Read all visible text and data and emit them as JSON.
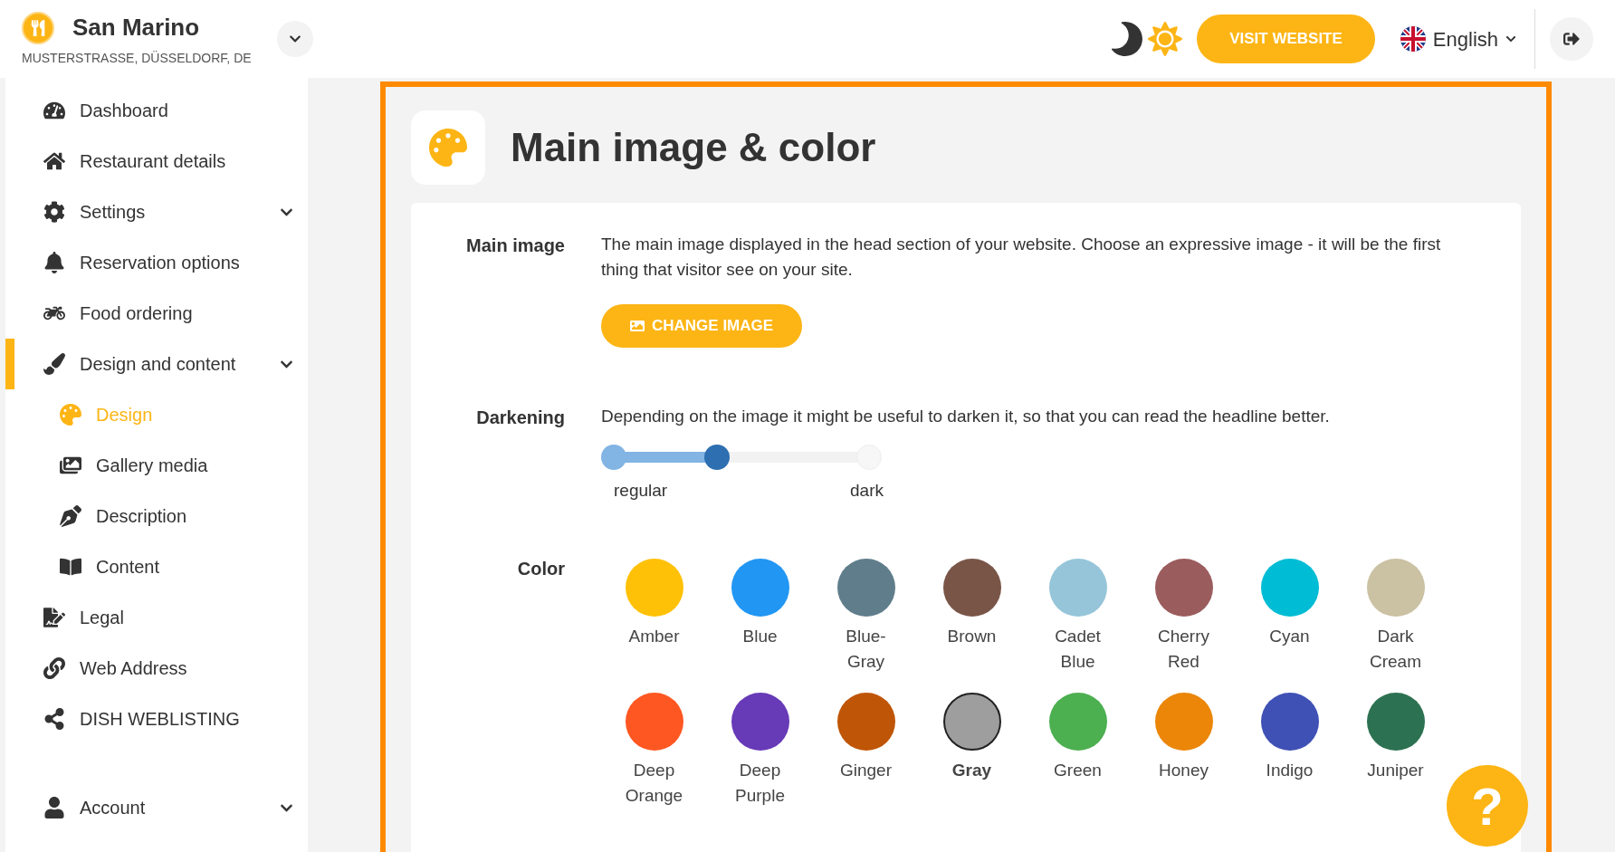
{
  "header": {
    "restaurant_name": "San Marino",
    "address": "MUSTERSTRASSE, DÜSSELDORF, DE",
    "visit_button": "VISIT WEBSITE",
    "language": "English"
  },
  "sidebar": {
    "items": [
      {
        "label": "Dashboard",
        "kind": "link",
        "selected": false
      },
      {
        "label": "Restaurant details",
        "kind": "link",
        "selected": false
      },
      {
        "label": "Settings",
        "kind": "group",
        "selected": false
      },
      {
        "label": "Reservation options",
        "kind": "link",
        "selected": false
      },
      {
        "label": "Food ordering",
        "kind": "link",
        "selected": false
      },
      {
        "label": "Design and content",
        "kind": "group",
        "selected": true,
        "children": [
          {
            "label": "Design",
            "selected": true
          },
          {
            "label": "Gallery media",
            "selected": false
          },
          {
            "label": "Description",
            "selected": false
          },
          {
            "label": "Content",
            "selected": false
          }
        ]
      },
      {
        "label": "Legal",
        "kind": "link",
        "selected": false
      },
      {
        "label": "Web Address",
        "kind": "link",
        "selected": false
      },
      {
        "label": "DISH WEBLISTING",
        "kind": "link",
        "selected": false
      }
    ],
    "account": {
      "label": "Account"
    }
  },
  "page": {
    "title": "Main image & color",
    "main_image": {
      "label": "Main image",
      "description": "The main image displayed in the head section of your website. Choose an expressive image - it will be the first thing that visitor see on your site.",
      "button": "CHANGE IMAGE"
    },
    "darkening": {
      "label": "Darkening",
      "description": "Depending on the image it might be useful to darken it, so that you can read the headline better.",
      "level": 0.4,
      "min_label": "regular",
      "max_label": "dark"
    },
    "color": {
      "label": "Color",
      "swatches": [
        {
          "name": "Amber",
          "color": "#ffc107",
          "selected": false
        },
        {
          "name": "Blue",
          "color": "#2196f3",
          "selected": false
        },
        {
          "name": "Blue-Gray",
          "color": "#607d8b",
          "selected": false
        },
        {
          "name": "Brown",
          "color": "#795548",
          "selected": false
        },
        {
          "name": "Cadet Blue",
          "color": "#96c5d9",
          "selected": false
        },
        {
          "name": "Cherry Red",
          "color": "#9b5c5e",
          "selected": false
        },
        {
          "name": "Cyan",
          "color": "#00bcd4",
          "selected": false
        },
        {
          "name": "Dark Cream",
          "color": "#cbc1a3",
          "selected": false
        },
        {
          "name": "Deep Orange",
          "color": "#ff5722",
          "selected": false
        },
        {
          "name": "Deep Purple",
          "color": "#673ab7",
          "selected": false
        },
        {
          "name": "Ginger",
          "color": "#bf5506",
          "selected": false
        },
        {
          "name": "Gray",
          "color": "#9e9e9e",
          "selected": true
        },
        {
          "name": "Green",
          "color": "#4caf50",
          "selected": false
        },
        {
          "name": "Honey",
          "color": "#eb8608",
          "selected": false
        },
        {
          "name": "Indigo",
          "color": "#3f51b5",
          "selected": false
        },
        {
          "name": "Juniper",
          "color": "#2c7151",
          "selected": false
        }
      ]
    }
  },
  "help_button": {
    "label": "?"
  }
}
